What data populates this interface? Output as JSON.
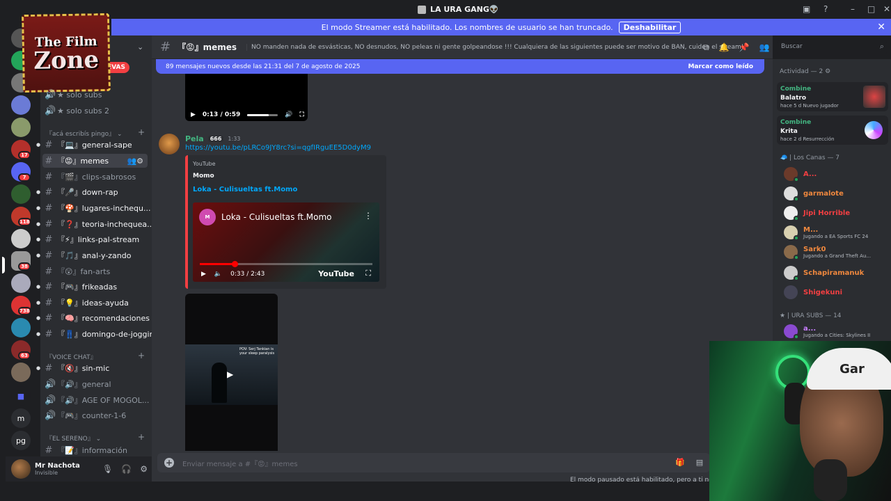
{
  "window": {
    "title": "LA URA GANG👽"
  },
  "streamer_notice": {
    "text": "El modo Streamer está habilitado. Los nombres de usuario se han truncado.",
    "button": "Deshabilitar"
  },
  "logo": {
    "line1": "The Film",
    "line2": "Zone"
  },
  "guild_badges": [
    "17",
    "7",
    "118",
    "38",
    "738",
    "63",
    "1"
  ],
  "guild_letters": [
    "m",
    "pg"
  ],
  "channels": {
    "nuevas_label": "NUEVAS",
    "top": [
      {
        "label": "★ solo subs",
        "type": "voice"
      },
      {
        "label": "★ solo subs 2",
        "type": "voice"
      }
    ],
    "cat1": "『acá escribís pingo』",
    "text": [
      {
        "label": "『💻』general-sape",
        "dim": false
      },
      {
        "label": "『😡』memes",
        "dim": false
      },
      {
        "label": "『🎬』clips-sabrosos",
        "dim": true
      },
      {
        "label": "『🎤』down-rap",
        "dim": false
      },
      {
        "label": "『🍄』lugares-inchequ...",
        "dim": false
      },
      {
        "label": "『❓』teoria-inchequea...",
        "dim": false
      },
      {
        "label": "『⚡』links-pal-stream",
        "dim": false
      },
      {
        "label": "『🎵』anal-y-zando",
        "dim": false
      },
      {
        "label": "『😲』fan-arts",
        "dim": true
      },
      {
        "label": "『🎮』frikeadas",
        "dim": false
      },
      {
        "label": "『💡』ideas-ayuda",
        "dim": false
      },
      {
        "label": "『🧠』recomendaciones",
        "dim": false
      },
      {
        "label": "『👖』domingo-de-joggin",
        "dim": false
      }
    ],
    "cat2": "『VOICE CHAT』",
    "voice": [
      {
        "label": "『🔇』sin-mic",
        "type": "text"
      },
      {
        "label": "『🔊』general",
        "type": "voice"
      },
      {
        "label": "『🔊』AGE OF MOGOL...",
        "type": "voice"
      },
      {
        "label": "『🎮』counter-1-6",
        "type": "voice"
      }
    ],
    "cat3": "『EL SERENO』",
    "info": "『📝』información"
  },
  "user": {
    "name": "Mr Nachota",
    "status": "Invisible"
  },
  "header": {
    "channel": "『😡』memes",
    "topic": "NO manden nada de esvásticas, NO desnudos, NO peleas ni gente golpeandose !!! Cualquiera de las siguientes puede ser motivo de BAN, cuiden el stream!",
    "search_placeholder": "Buscar"
  },
  "new_messages": {
    "text": "89 mensajes nuevos desde las 21:31 del 7 de agosto de 2025",
    "mark": "Marcar como leído"
  },
  "video1": {
    "time": "0:13 / 0:59"
  },
  "message": {
    "author": "Pela",
    "tag": "666",
    "time": "1:33",
    "link": "https://youtu.be/pLRCo9JY8rc?si=qgfIRguEE5D0dyM9",
    "embed": {
      "provider": "YouTube",
      "author": "Momo",
      "title": "Loka - Culisueltas ft.Momo",
      "video_title": "Loka - Culisueltas ft.Momo",
      "time": "0:33 / 2:43",
      "yt_logo": "YouTube",
      "channel_icon": "M"
    },
    "progress": 0.2
  },
  "video2": {
    "caption": "POV: Serj Tankian is your sleep paralysis"
  },
  "composer": {
    "placeholder": "Enviar mensaje a #『😡』memes"
  },
  "paused": "El modo pausado está habilitado, pero a ti no te af",
  "members": {
    "activity_header": "Actividad — 2",
    "activities": [
      {
        "game": "Combine",
        "title": "Balatro",
        "meta": "hace 5 d   Nuevo jugador"
      },
      {
        "game": "Combine",
        "title": "Krita",
        "meta": "hace 2 d   Resurrección"
      }
    ],
    "group1": "🧢 | Los Canas — 7",
    "list": [
      {
        "name": "A...",
        "status": "",
        "color": "#f23f42"
      },
      {
        "name": "garmalote",
        "status": "",
        "color": "#f0883e"
      },
      {
        "name": "Jipi Horrible",
        "status": "",
        "color": "#f23f42"
      },
      {
        "name": "M...",
        "status": "Jugando a EA Sports FC 24",
        "color": "#f0883e"
      },
      {
        "name": "Sark0",
        "status": "Jugando a Grand Theft Au...",
        "color": "#f0883e"
      },
      {
        "name": "Schapiramanuk",
        "status": "",
        "color": "#f0883e"
      },
      {
        "name": "Shigekuni",
        "status": "",
        "color": "#f23f42"
      }
    ],
    "group2": "★ | URA SUBS — 14",
    "list2": [
      {
        "name": "a...",
        "status": "Jugando a Cities: Skylines II",
        "color": "#c77dff"
      }
    ]
  },
  "webcam": {
    "cap_text": "Gar"
  }
}
